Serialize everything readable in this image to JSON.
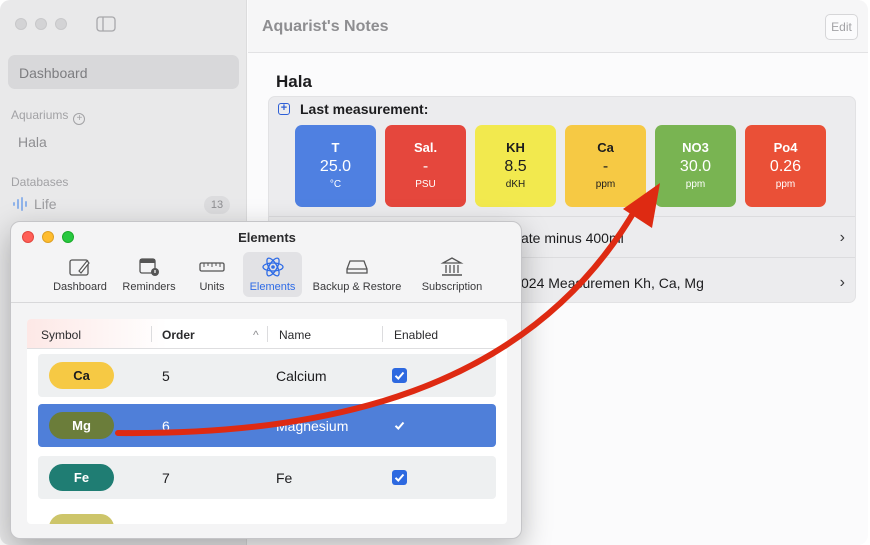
{
  "sidebar": {
    "dashboard": "Dashboard",
    "aquariums_section": "Aquariums",
    "aquarium_item": "Hala",
    "databases_section": "Databases",
    "life_item": "Life",
    "life_count": "13"
  },
  "content": {
    "app_title": "Aquarist's Notes",
    "edit_label": "Edit",
    "aquarium_name": "Hala",
    "last_measurement_label": "Last measurement:",
    "cards": [
      {
        "symbol": "T",
        "value": "25.0",
        "unit": "°C",
        "color": "#4f80e1"
      },
      {
        "symbol": "Sal.",
        "value": "-",
        "unit": "PSU",
        "color": "#e5473d"
      },
      {
        "symbol": "KH",
        "value": "8.5",
        "unit": "dKH",
        "color": "#f2e94e"
      },
      {
        "symbol": "Ca",
        "value": "-",
        "unit": "ppm",
        "color": "#f6c944"
      },
      {
        "symbol": "NO3",
        "value": "30.0",
        "unit": "ppm",
        "color": "#79b452"
      },
      {
        "symbol": "Po4",
        "value": "0.26",
        "unit": "ppm",
        "color": "#ea5037"
      }
    ],
    "rows": [
      {
        "text": "ate minus 400ml"
      },
      {
        "text": "024  Measuremen Kh, Ca, Mg"
      }
    ]
  },
  "prefs": {
    "title": "Elements",
    "toolbar": [
      {
        "label": "Dashboard",
        "icon": "dashboard-edit-icon"
      },
      {
        "label": "Reminders",
        "icon": "reminders-calendar-icon"
      },
      {
        "label": "Units",
        "icon": "ruler-icon"
      },
      {
        "label": "Elements",
        "icon": "atom-icon"
      },
      {
        "label": "Backup & Restore",
        "icon": "drive-icon"
      },
      {
        "label": "Subscription",
        "icon": "bank-icon"
      }
    ],
    "table": {
      "headers": {
        "symbol": "Symbol",
        "order": "Order",
        "sort_indicator": "^",
        "name": "Name",
        "enabled": "Enabled"
      },
      "rows": [
        {
          "symbol": "Ca",
          "order": "5",
          "name": "Calcium",
          "enabled": true,
          "pill_color": "#f6c944",
          "pill_text_color": "#1c1c1e"
        },
        {
          "symbol": "Mg",
          "order": "6",
          "name": "Magnesium",
          "enabled": true,
          "pill_color": "#6b7d3a",
          "pill_text_color": "#ffffff"
        },
        {
          "symbol": "Fe",
          "order": "7",
          "name": "Fe",
          "enabled": true,
          "pill_color": "#1f7d73",
          "pill_text_color": "#ffffff"
        }
      ]
    }
  },
  "colors": {
    "arrow": "#de2a12",
    "accent": "#2e6be6",
    "selection": "#4f7fd9"
  }
}
